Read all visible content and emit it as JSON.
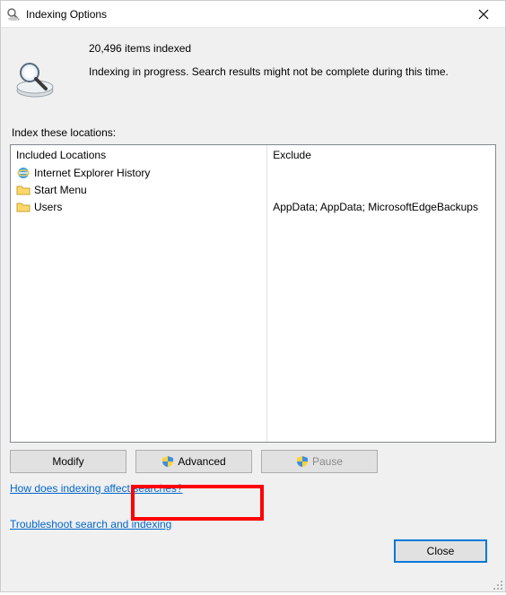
{
  "title": "Indexing Options",
  "status": {
    "count_text": "20,496 items indexed",
    "progress_text": "Indexing in progress. Search results might not be complete during this time."
  },
  "section_label": "Index these locations:",
  "columns": {
    "included": "Included Locations",
    "exclude": "Exclude"
  },
  "rows": [
    {
      "icon": "ie",
      "name": "Internet Explorer History",
      "exclude": ""
    },
    {
      "icon": "folder",
      "name": "Start Menu",
      "exclude": ""
    },
    {
      "icon": "folder",
      "name": "Users",
      "exclude": "AppData; AppData; MicrosoftEdgeBackups"
    }
  ],
  "buttons": {
    "modify": "Modify",
    "advanced": "Advanced",
    "pause": "Pause",
    "close": "Close"
  },
  "links": {
    "how": "How does indexing affect searches?",
    "troubleshoot": "Troubleshoot search and indexing"
  }
}
